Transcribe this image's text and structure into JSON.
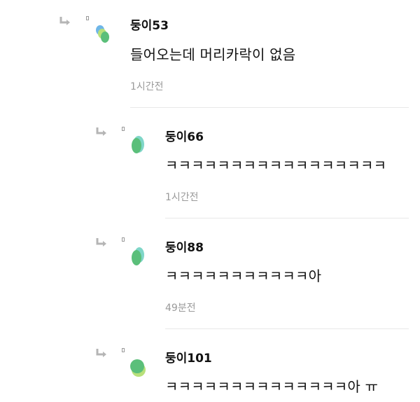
{
  "comments": [
    {
      "nickname": "둥이53",
      "text": "들어오는데 머리카락이 없음",
      "time": "1시간전"
    },
    {
      "nickname": "둥이66",
      "text": "ㅋㅋㅋㅋㅋㅋㅋㅋㅋㅋㅋㅋㅋㅋㅋㅋㅋ",
      "time": "1시간전"
    },
    {
      "nickname": "둥이88",
      "text": "ㅋㅋㅋㅋㅋㅋㅋㅋㅋㅋㅋ아",
      "time": "49분전"
    },
    {
      "nickname": "둥이101",
      "text": "ㅋㅋㅋㅋㅋㅋㅋㅋㅋㅋㅋㅋㅋㅋ아 ㅠ"
    }
  ],
  "colors": {
    "reply_arrow": "#b5b5b5",
    "time": "#9a9a9a",
    "divider": "#e8e8e8",
    "avatar_green": "#5bbf7a",
    "avatar_teal": "#7fd6c8",
    "avatar_lime": "#b8e07a",
    "avatar_blue": "#6fb6e8"
  }
}
